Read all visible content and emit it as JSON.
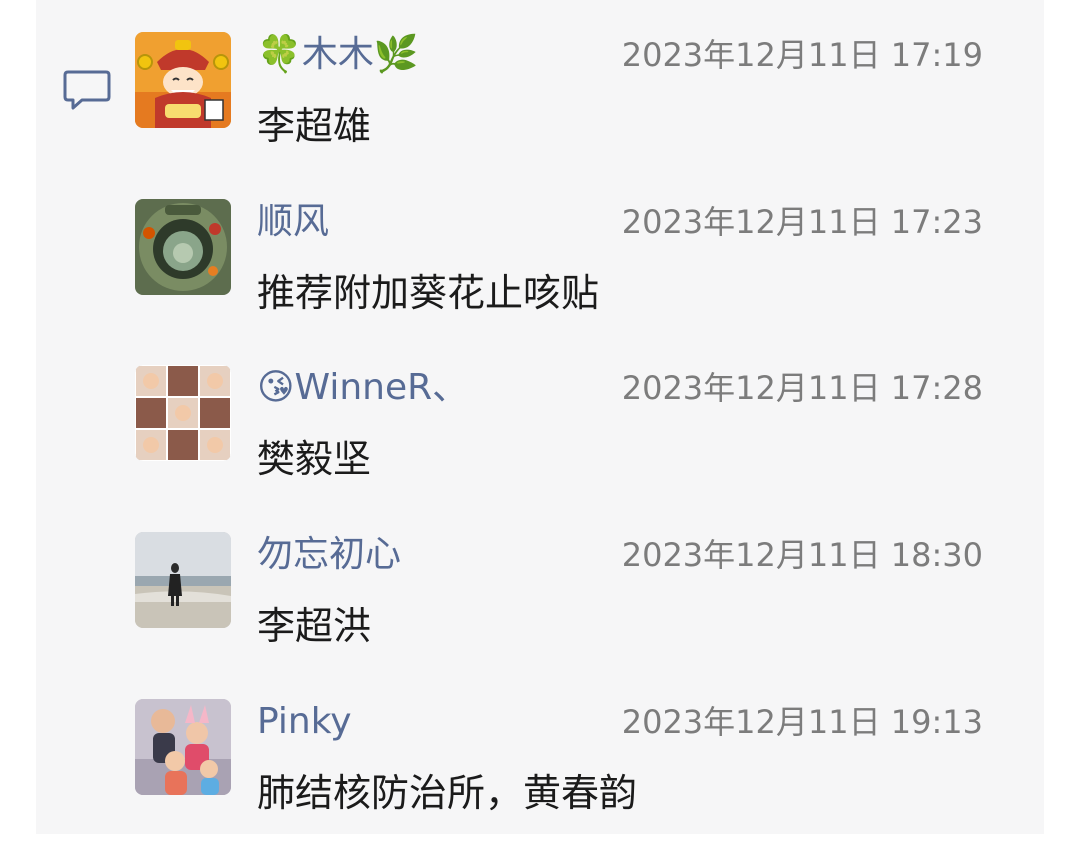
{
  "comments": [
    {
      "name": "🍀木木🌿",
      "time": "2023年12月11日 17:19",
      "text": "李超雄",
      "avatar": "god-of-wealth-cartoon-avatar"
    },
    {
      "name": "顺风",
      "time": "2023年12月11日 17:23",
      "text": "推荐附加葵花止咳贴",
      "avatar": "fisheye-photo-avatar"
    },
    {
      "name": "😘WinneR、",
      "time": "2023年12月11日 17:28",
      "text": "樊毅坚",
      "avatar": "photo-grid-avatar"
    },
    {
      "name": "勿忘初心",
      "time": "2023年12月11日 18:30",
      "text": "李超洪",
      "avatar": "beach-person-avatar"
    },
    {
      "name": "Pinky",
      "time": "2023年12月11日 19:13",
      "text": "肺结核防治所，黄春韵",
      "avatar": "family-photo-avatar"
    }
  ],
  "colors": {
    "name": "#576b95",
    "time": "#7c7c7c",
    "text": "#1b1b1b",
    "panel": "#f6f6f7"
  },
  "icons": {
    "comment_section": "comment-bubble-icon"
  }
}
